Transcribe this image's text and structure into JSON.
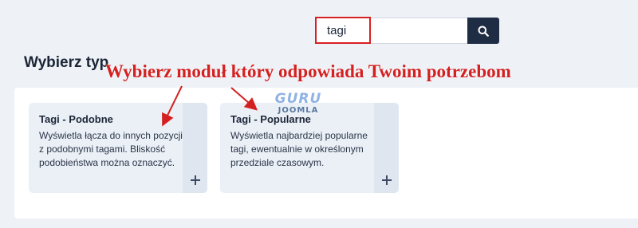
{
  "search": {
    "value": "tagi",
    "button_icon": "search-icon"
  },
  "page": {
    "title": "Wybierz typ"
  },
  "annotation": {
    "text": "Wybierz moduł który odpowiada Twoim potrzebom",
    "color": "#d42020"
  },
  "watermark": {
    "line1": "GURU",
    "line2": "JOOMLA"
  },
  "modules": [
    {
      "title": "Tagi - Podobne",
      "description": "Wyświetla łącza do innych pozycji z podobnymi tagami. Bliskość podobieństwa można oznaczyć.",
      "add_icon": "plus-icon"
    },
    {
      "title": "Tagi - Popularne",
      "description": "Wyświetla najbardziej popularne tagi, ewentualnie w określonym przedziale czasowym.",
      "add_icon": "plus-icon"
    }
  ],
  "colors": {
    "accent_dark": "#1f2d44",
    "highlight": "#d92020",
    "card_bg": "#ebf0f7"
  }
}
